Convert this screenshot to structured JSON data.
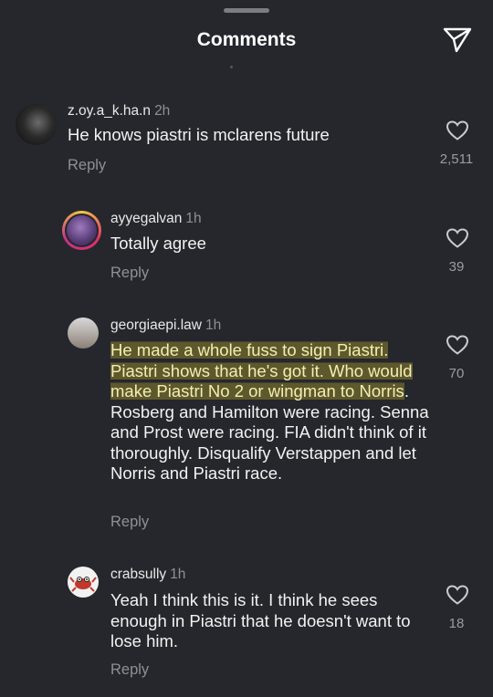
{
  "header": {
    "title": "Comments"
  },
  "comments": [
    {
      "username": "z.oy.a_k.ha.n",
      "time": "2h",
      "text": "He knows piastri is mclarens future",
      "reply": "Reply",
      "likes": "2,511"
    },
    {
      "username": "ayyegalvan",
      "time": "1h",
      "text": "Totally agree",
      "reply": "Reply",
      "likes": "39"
    },
    {
      "username": "georgiaepi.law",
      "time": "1h",
      "text_highlighted": "He made a whole fuss to sign Piastri. Piastri shows that he's got it. Who would make Piastri No 2 or wingman to Norris",
      "text_rest": ". Rosberg and Hamilton were racing. Senna and Prost were racing. FIA didn't think of it thoroughly. Disqualify Verstappen and let Norris and Piastri race.",
      "reply": "Reply",
      "likes": "70"
    },
    {
      "username": "crabsully",
      "time": "1h",
      "text": "Yeah I think this is it. I think he sees enough in Piastri that he doesn't want to lose him.",
      "reply": "Reply",
      "likes": "18"
    }
  ],
  "icons": {
    "send": "send-icon",
    "like": "heart-icon"
  },
  "colors": {
    "background": "#25272d",
    "muted": "#8e9096",
    "highlight": "#8c802d"
  }
}
